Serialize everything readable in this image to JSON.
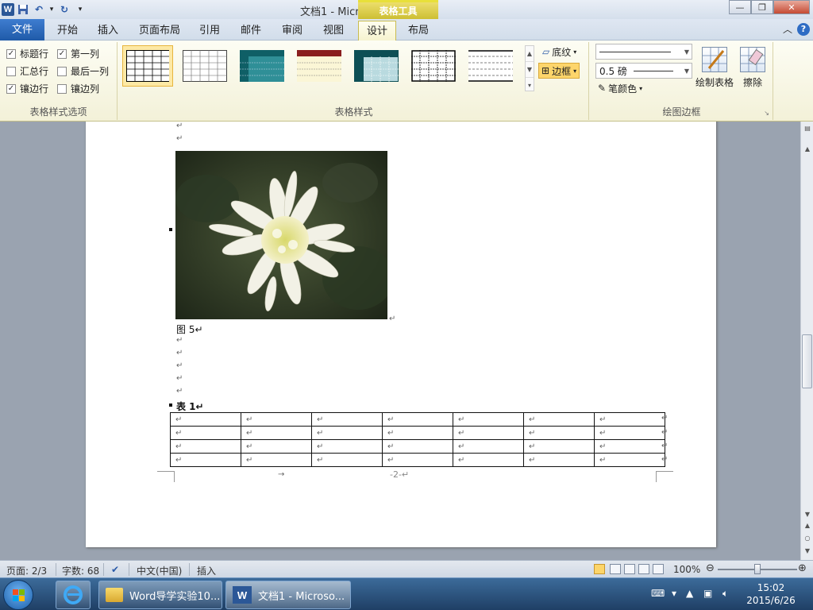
{
  "window": {
    "title": "文档1 - Microsoft Word",
    "context_tab_title": "表格工具",
    "qat_dropdown": "▾"
  },
  "tabs": {
    "file": "文件",
    "items": [
      "开始",
      "插入",
      "页面布局",
      "引用",
      "邮件",
      "审阅",
      "视图",
      "设计",
      "布局"
    ],
    "active": "设计"
  },
  "ribbon": {
    "style_options": {
      "label": "表格样式选项",
      "options": [
        {
          "label": "标题行",
          "checked": true
        },
        {
          "label": "第一列",
          "checked": true
        },
        {
          "label": "汇总行",
          "checked": false
        },
        {
          "label": "最后一列",
          "checked": false
        },
        {
          "label": "镶边行",
          "checked": true
        },
        {
          "label": "镶边列",
          "checked": false
        }
      ]
    },
    "table_styles": {
      "label": "表格样式",
      "shading_label": "底纹",
      "borders_label": "边框"
    },
    "draw_borders": {
      "label": "绘图边框",
      "line_weight": "0.5 磅",
      "pen_color_label": "笔颜色",
      "draw_table_label": "绘制表格",
      "eraser_label": "擦除"
    }
  },
  "document": {
    "paragraph_mark": "↵",
    "figure_caption": "图 5↵",
    "table_caption": "表 1↵",
    "footer_text": "-2-↵",
    "tab_arrow": "→"
  },
  "statusbar": {
    "page": "页面: 2/3",
    "words": "字数: 68",
    "language": "中文(中国)",
    "mode": "插入",
    "zoom": "100%"
  },
  "taskbar": {
    "folder_window": "Word导学实验10...",
    "word_window": "文档1 - Microso...",
    "time": "15:02",
    "date": "2015/6/26"
  }
}
